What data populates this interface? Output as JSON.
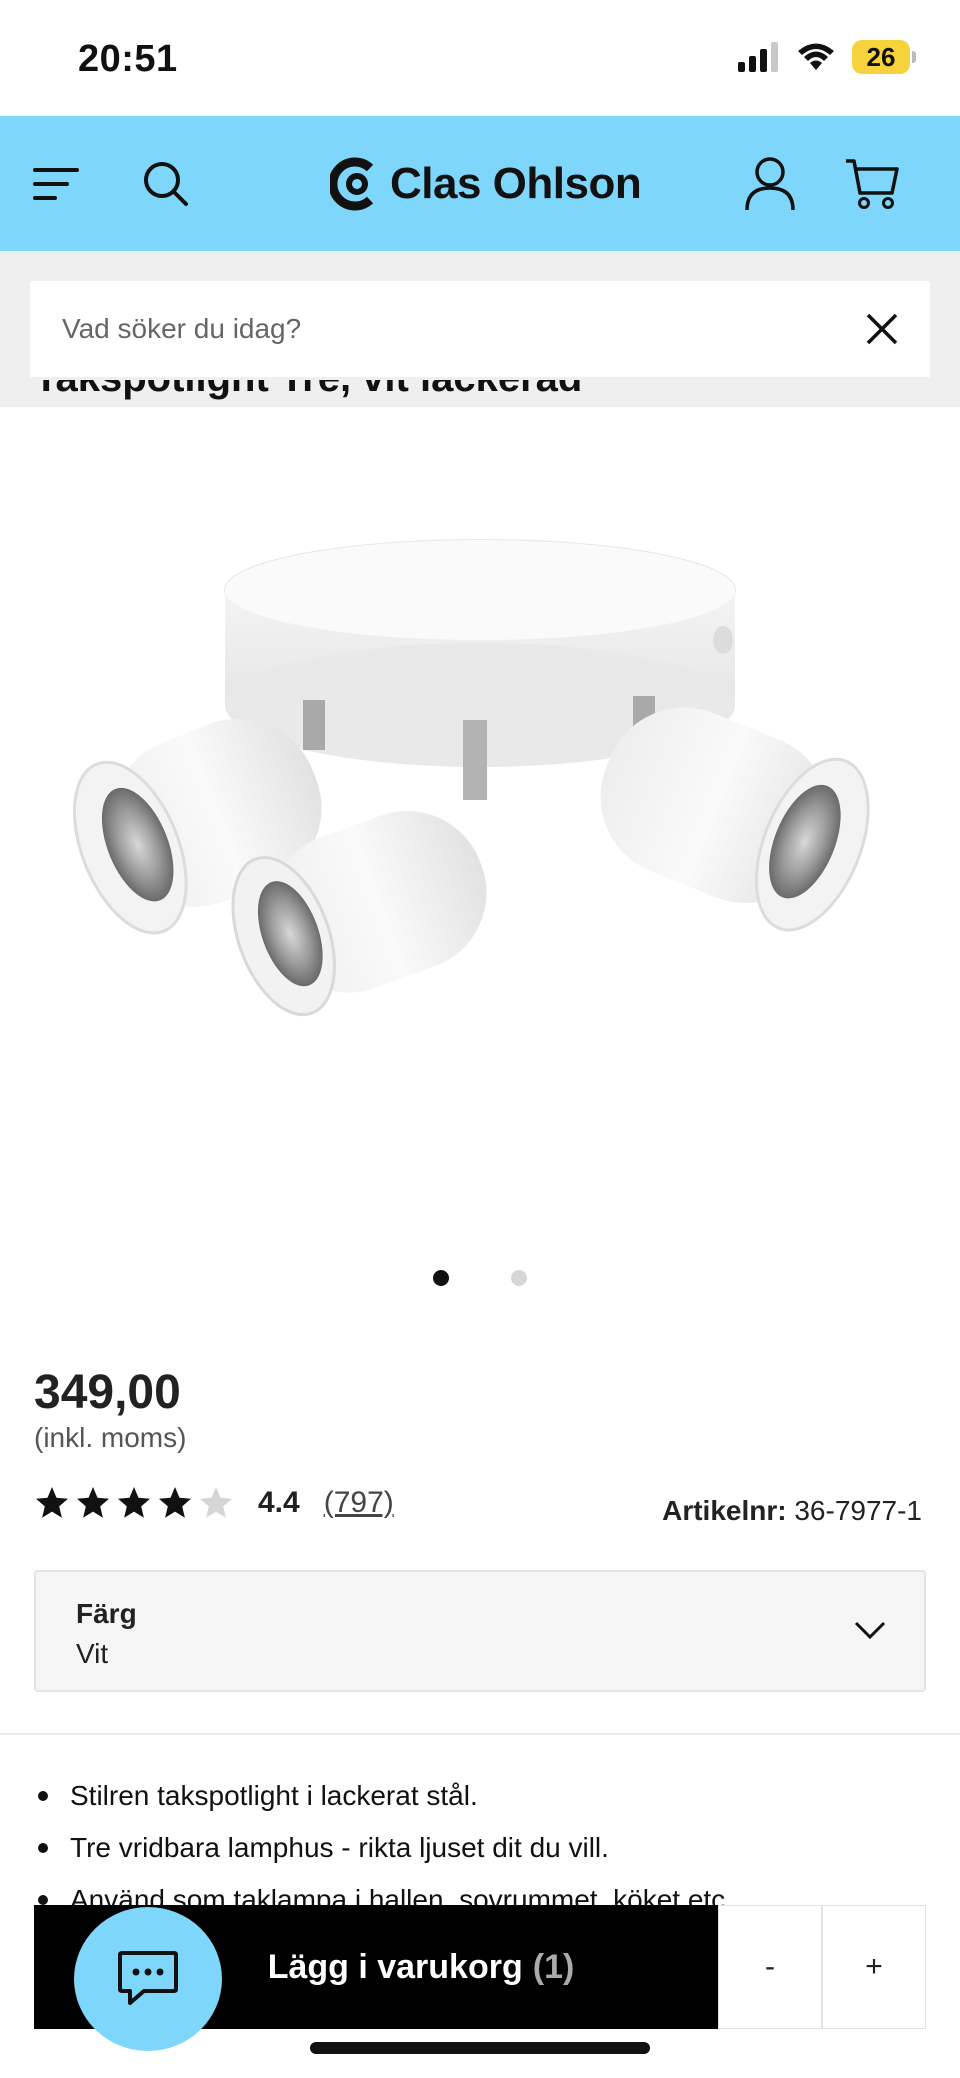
{
  "status_bar": {
    "time": "20:51",
    "battery": "26"
  },
  "header": {
    "logo_text": "Clas Ohlson"
  },
  "search": {
    "placeholder": "Vad söker du idag?"
  },
  "product": {
    "title_partial": "Takspotlight Tre, vit lackerad",
    "price": "349,00",
    "price_note": "(inkl. moms)",
    "rating": {
      "value": "4.4",
      "count": "(797)",
      "stars": 4.4
    },
    "article_label": "Artikelnr:",
    "article_number": "36-7977-1",
    "color": {
      "label": "Färg",
      "value": "Vit"
    },
    "bullets": [
      "Stilren takspotlight i lackerat stål.",
      "Tre vridbara lamphus - rikta ljuset dit du vill.",
      "Använd som taklampa i hallen, sovrummet, köket etc."
    ]
  },
  "carousel": {
    "total": 2,
    "active": 1
  },
  "cart_bar": {
    "add_label": "Lägg i varukorg",
    "qty": "(1)",
    "minus": "-",
    "plus": "+"
  },
  "colors": {
    "header_bg": "#7fd6fb",
    "chat_bg": "#7fd6fb",
    "battery": "#f6d33d"
  }
}
